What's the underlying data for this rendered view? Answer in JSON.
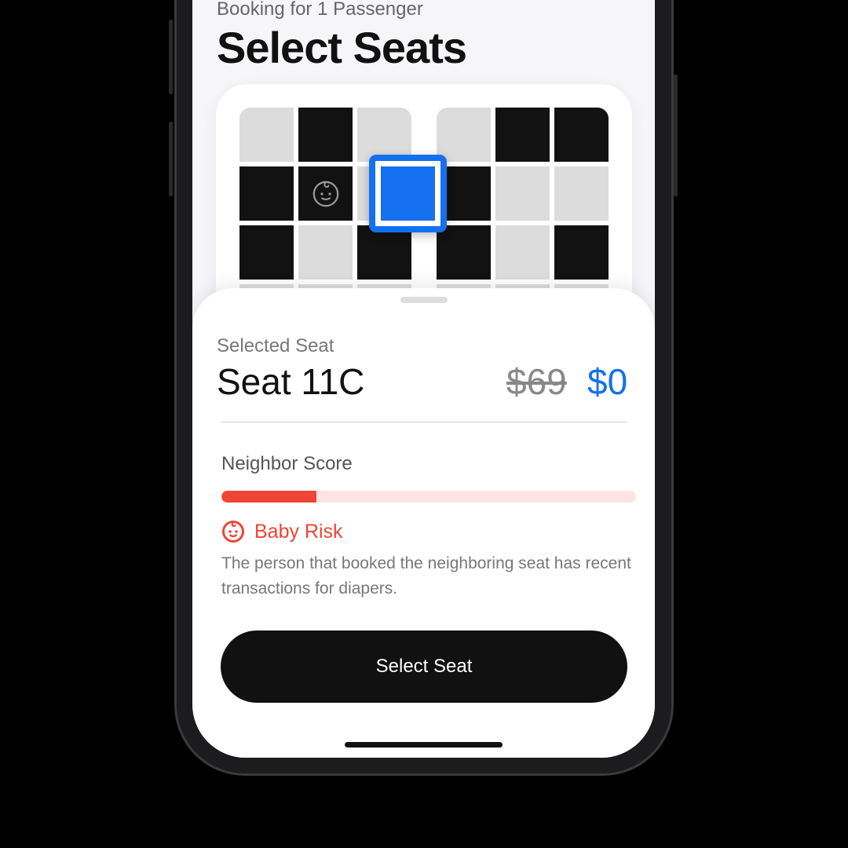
{
  "header": {
    "subtitle": "Booking for 1 Passenger",
    "title": "Select Seats"
  },
  "seat_map": {
    "left_block": [
      [
        "available",
        "occupied",
        "available"
      ],
      [
        "occupied",
        "occupied-baby",
        "selected"
      ],
      [
        "occupied",
        "available",
        "occupied"
      ]
    ],
    "right_block": [
      [
        "available",
        "occupied",
        "occupied"
      ],
      [
        "occupied",
        "available",
        "available"
      ],
      [
        "occupied",
        "available",
        "occupied"
      ]
    ],
    "selected_color": "#1570ef"
  },
  "sheet": {
    "label": "Selected Seat",
    "seat": "Seat 11C",
    "old_price": "$69",
    "new_price": "$0",
    "score_label": "Neighbor Score",
    "score_fraction": 0.23,
    "risk_icon": "baby-face-icon",
    "risk_label": "Baby Risk",
    "risk_color": "#f04438",
    "description": "The person that booked the neighboring seat has recent transactions for diapers.",
    "button": "Select Seat"
  }
}
